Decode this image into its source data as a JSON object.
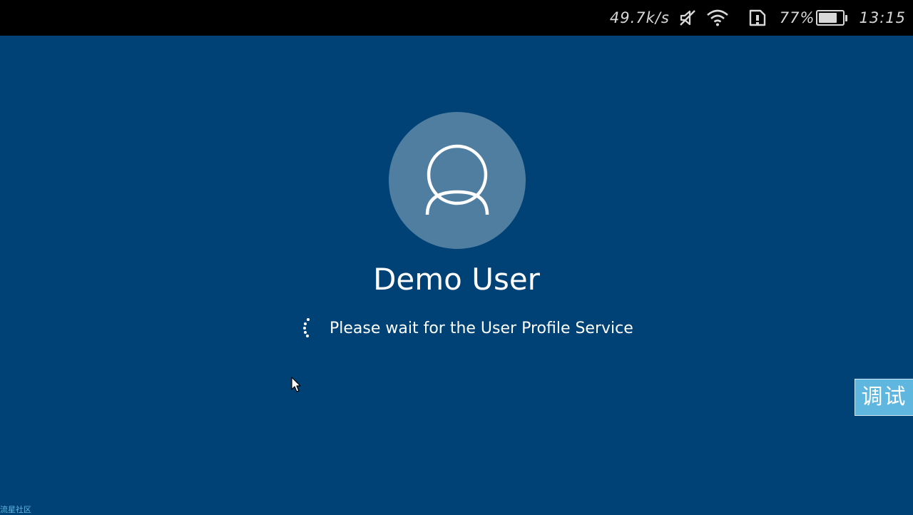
{
  "status_bar": {
    "network_speed": "49.7k/s",
    "battery_percent": "77%",
    "battery_level": 0.77,
    "time": "13:15",
    "icons": [
      "mute-icon",
      "wifi-icon",
      "sim-alert-icon",
      "battery-icon"
    ]
  },
  "login": {
    "user_name": "Demo User",
    "status_message": "Please wait for the User Profile Service"
  },
  "overlay": {
    "debug_button_label": "调试",
    "watermark": "流星社区"
  },
  "colors": {
    "background": "#004275",
    "avatar_circle": "#4f7ea1",
    "debug_button": "#5fb6df"
  }
}
